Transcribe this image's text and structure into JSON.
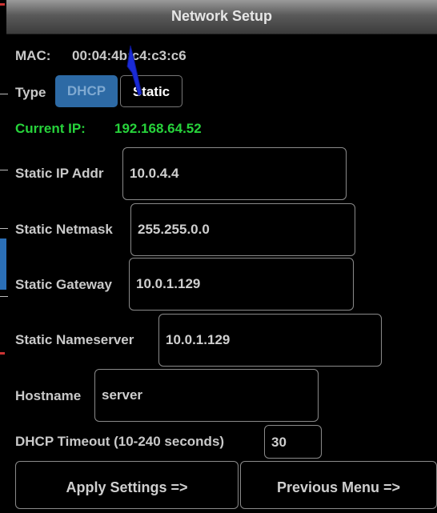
{
  "window": {
    "title": "Network Setup"
  },
  "mac": {
    "label": "MAC:",
    "value": "00:04:4b:c4:c3:c6"
  },
  "type": {
    "label": "Type",
    "dhcp_label": "DHCP",
    "static_label": "Static",
    "selected": "Static"
  },
  "current_ip": {
    "label": "Current IP:",
    "value": "192.168.64.52"
  },
  "fields": {
    "static_ip": {
      "label": "Static IP Addr",
      "value": "10.0.4.4"
    },
    "netmask": {
      "label": "Static Netmask",
      "value": "255.255.0.0"
    },
    "gateway": {
      "label": "Static Gateway",
      "value": "10.0.1.129"
    },
    "nameserver": {
      "label": "Static Nameserver",
      "value": "10.0.1.129"
    },
    "hostname": {
      "label": "Hostname",
      "value": "server"
    },
    "dhcp_timeout": {
      "label": "DHCP Timeout (10-240 seconds)",
      "value": "30"
    }
  },
  "buttons": {
    "apply": "Apply Settings =>",
    "previous": "Previous Menu =>"
  },
  "colors": {
    "accent_green": "#27d33b",
    "dhcp_blue": "#2d6aa5"
  }
}
